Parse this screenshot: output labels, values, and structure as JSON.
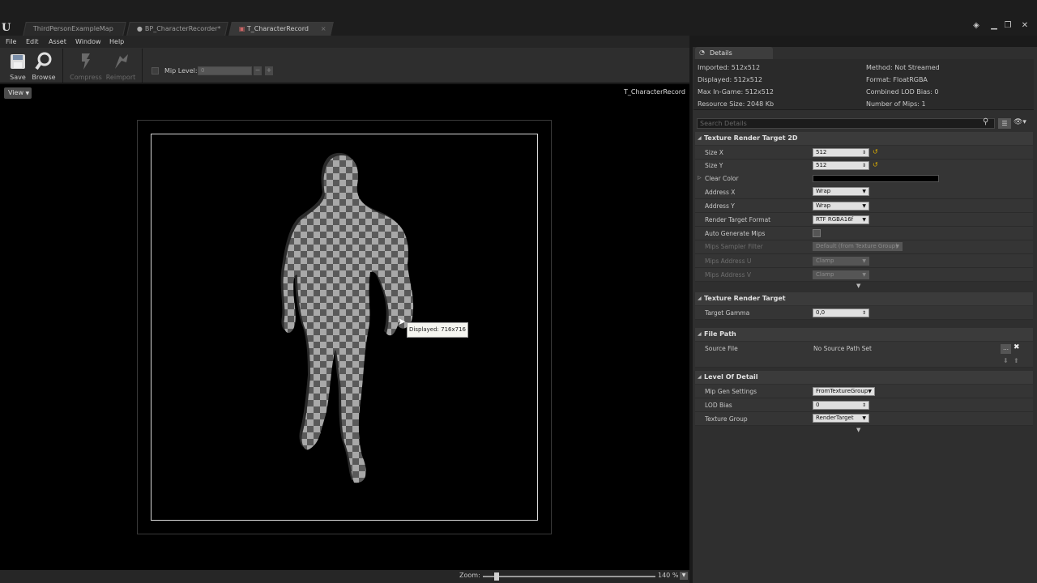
{
  "tabs": [
    {
      "label": "ThirdPersonExampleMap"
    },
    {
      "label": "BP_CharacterRecorder*"
    },
    {
      "label": "T_CharacterRecord"
    }
  ],
  "menu": [
    "File",
    "Edit",
    "Asset",
    "Window",
    "Help"
  ],
  "toolbar": {
    "save": "Save",
    "browse": "Browse",
    "compress": "Compress",
    "reimport": "Reimport",
    "mip_label": "Mip Level:",
    "mip_value": "0"
  },
  "viewport": {
    "view_button": "View",
    "asset_name": "T_CharacterRecord",
    "tooltip": "Displayed: 716x716"
  },
  "status": {
    "zoom_label": "Zoom:",
    "zoom_value": "140 %",
    "zoom_fraction": 0.08
  },
  "details": {
    "tab": "Details",
    "info": {
      "imported": "Imported: 512x512",
      "displayed": "Displayed: 512x512",
      "max_in_game": "Max In-Game: 512x512",
      "resource_size": "Resource Size: 2048 Kb",
      "method": "Method: Not Streamed",
      "format": "Format: FloatRGBA",
      "combined_lod": "Combined LOD Bias: 0",
      "num_mips": "Number of Mips: 1"
    },
    "search_placeholder": "Search Details",
    "cat_trt2d": "Texture Render Target 2D",
    "size_x_label": "Size X",
    "size_x": "512",
    "size_y_label": "Size Y",
    "size_y": "512",
    "clear_color_label": "Clear Color",
    "clear_color": "#000000",
    "address_x_label": "Address X",
    "address_x": "Wrap",
    "address_y_label": "Address Y",
    "address_y": "Wrap",
    "rt_format_label": "Render Target Format",
    "rt_format": "RTF RGBA16f",
    "auto_mips_label": "Auto Generate Mips",
    "mips_filter_label": "Mips Sampler Filter",
    "mips_filter": "Default (from Texture Group)",
    "mips_u_label": "Mips Address U",
    "mips_u": "Clamp",
    "mips_v_label": "Mips Address V",
    "mips_v": "Clamp",
    "cat_trt": "Texture Render Target",
    "gamma_label": "Target Gamma",
    "gamma": "0,0",
    "cat_filepath": "File Path",
    "source_file_label": "Source File",
    "source_file": "No Source Path Set",
    "cat_lod": "Level Of Detail",
    "mip_gen_label": "Mip Gen Settings",
    "mip_gen": "FromTextureGroup",
    "lod_bias_label": "LOD Bias",
    "lod_bias": "0",
    "tex_group_label": "Texture Group",
    "tex_group": "RenderTarget"
  }
}
